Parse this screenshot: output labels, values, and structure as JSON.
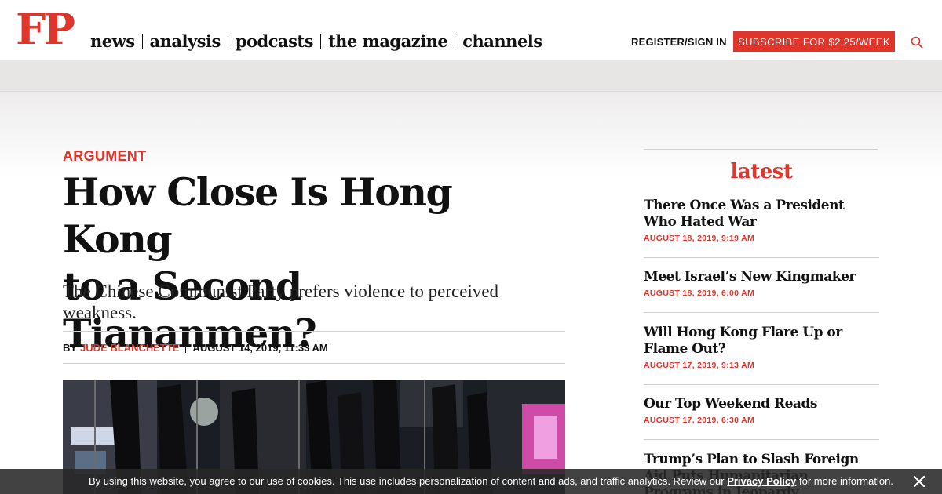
{
  "header": {
    "logo": "FP",
    "nav": [
      "news",
      "analysis",
      "podcasts",
      "the magazine",
      "channels"
    ],
    "register": "REGISTER/SIGN IN",
    "subscribe": "SUBSCRIBE FOR $2.25/WEEK",
    "search_icon": "search-icon"
  },
  "article": {
    "category": "ARGUMENT",
    "headline_line1": "How Close Is Hong Kong",
    "headline_line2": "to a Second Tiananmen?",
    "dek": "The Chinese Communist Party prefers violence to perceived weakness.",
    "by": "BY",
    "author": "JUDE BLANCHETTE",
    "date": "AUGUST 14, 2019, 11:33 AM"
  },
  "sidebar": {
    "title": "latest",
    "items": [
      {
        "title": "There Once Was a President Who Hated War",
        "date": "AUGUST 18, 2019, 9:19 AM"
      },
      {
        "title": "Meet Israel’s New Kingmaker",
        "date": "AUGUST 18, 2019, 6:00 AM"
      },
      {
        "title": "Will Hong Kong Flare Up or Flame Out?",
        "date": "AUGUST 17, 2019, 9:13 AM"
      },
      {
        "title": "Our Top Weekend Reads",
        "date": "AUGUST 17, 2019, 6:30 AM"
      },
      {
        "title": "Trump’s Plan to Slash Foreign Aid Puts Humanitarian Programs in Jeopardy",
        "date": ""
      }
    ]
  },
  "cookie": {
    "text_before": "By using this website, you agree to our use of cookies. This use includes personalization of content and ads, and traffic analytics. Review our ",
    "link": "Privacy Policy",
    "text_after": " for more information.",
    "close_icon": "close-icon"
  },
  "colors": {
    "accent": "#e0352b",
    "text": "#111111",
    "adband": "#e8e6e5"
  }
}
